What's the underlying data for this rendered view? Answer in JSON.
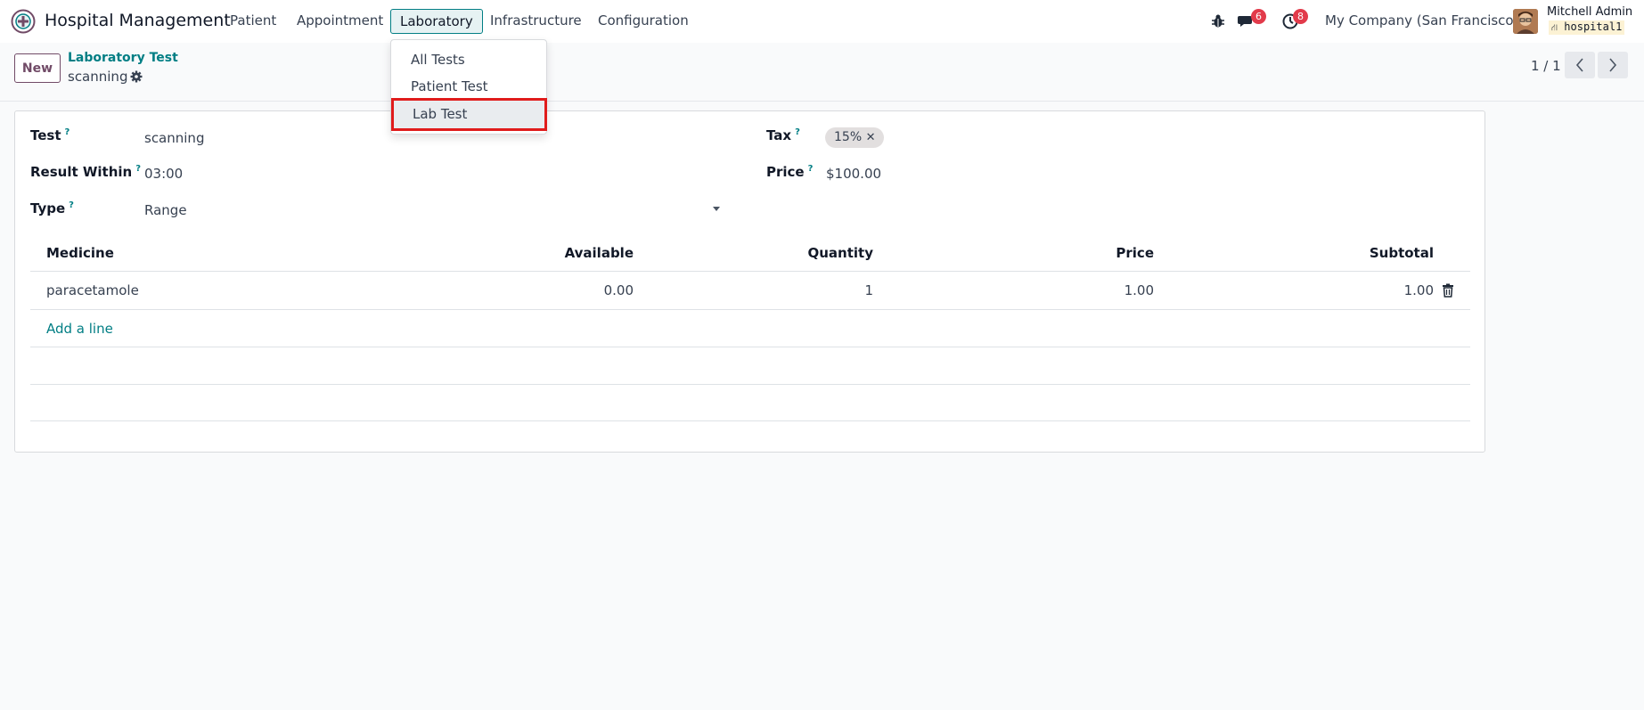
{
  "navbar": {
    "app_title": "Hospital Management",
    "menus": [
      "Patient",
      "Appointment",
      "Laboratory",
      "Infrastructure",
      "Configuration"
    ],
    "active_menu": "Laboratory",
    "messages_count": "6",
    "activities_count": "8",
    "company": "My Company (San Francisco)",
    "user_name": "Mitchell Admin",
    "database": "hospital1",
    "accent_color": "#017e84"
  },
  "laboratory_menu": {
    "items": [
      "All Tests",
      "Patient Test",
      "Lab Test"
    ],
    "highlighted": "Lab Test"
  },
  "control_panel": {
    "new_label": "New",
    "breadcrumb": "Laboratory Test",
    "record_name": "scanning",
    "pager": "1 / 1"
  },
  "form": {
    "test_label": "Test",
    "test_value": "scanning",
    "result_within_label": "Result Within",
    "result_within_value": "03:00",
    "type_label": "Type",
    "type_value": "Range",
    "tax_label": "Tax",
    "tax_tag": "15%",
    "price_label": "Price",
    "price_value": "$100.00",
    "help_mark": "?"
  },
  "medicine_table": {
    "columns": {
      "medicine": "Medicine",
      "available": "Available",
      "quantity": "Quantity",
      "price": "Price",
      "subtotal": "Subtotal"
    },
    "rows": [
      {
        "medicine": "paracetamole",
        "available": "0.00",
        "quantity": "1",
        "price": "1.00",
        "subtotal": "1.00"
      }
    ],
    "add_line_label": "Add a line"
  }
}
